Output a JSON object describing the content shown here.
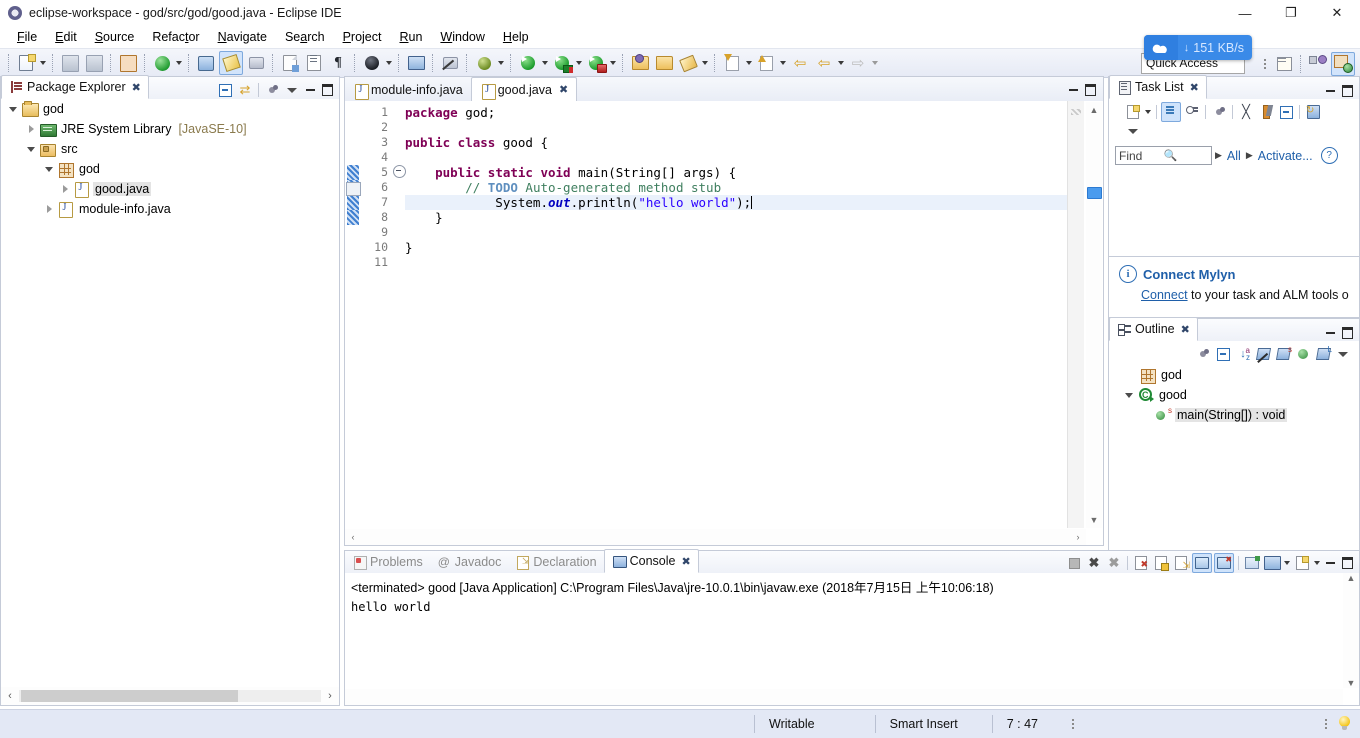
{
  "window": {
    "title": "eclipse-workspace - god/src/god/good.java - Eclipse IDE",
    "icon": "eclipse-icon",
    "minimize": "—",
    "maximize": "❐",
    "close": "✕"
  },
  "menubar": {
    "items": [
      {
        "label": "File",
        "mnemonic": "F"
      },
      {
        "label": "Edit",
        "mnemonic": "E"
      },
      {
        "label": "Source",
        "mnemonic": "S"
      },
      {
        "label": "Refactor",
        "mnemonic": "t"
      },
      {
        "label": "Navigate",
        "mnemonic": "N"
      },
      {
        "label": "Search",
        "mnemonic": "a"
      },
      {
        "label": "Project",
        "mnemonic": "P"
      },
      {
        "label": "Run",
        "mnemonic": "R"
      },
      {
        "label": "Window",
        "mnemonic": "W"
      },
      {
        "label": "Help",
        "mnemonic": "H"
      }
    ]
  },
  "toolbar": {
    "icons": [
      "new-wizard-icon",
      "save-icon",
      "save-all-icon",
      "new-java-project-icon",
      "refresh-icon",
      "debug-skip-icon",
      "edit-pencil-icon",
      "link-icon",
      "export-icon",
      "toggle-block-icon",
      "pilcrow-icon",
      "user-icon",
      "console-icon",
      "no-link-icon",
      "bug-icon",
      "run-icon",
      "run-debug-icon",
      "run-coverage-icon",
      "open-type-icon",
      "open-task-icon",
      "search-icon",
      "next-annotation-icon",
      "previous-annotation-icon",
      "back-icon",
      "forward-icon"
    ]
  },
  "quick_access": {
    "placeholder": "Quick Access",
    "label": "Quick Access"
  },
  "network_badge": {
    "icon": "cloud-icon",
    "arrow": "↓",
    "speed": "151 KB/s"
  },
  "perspective_bar": {
    "buttons": [
      "open-perspective-icon",
      "resource-perspective-icon",
      "java-perspective-icon"
    ],
    "active": "java-perspective-icon"
  },
  "package_explorer": {
    "tab_label": "Package Explorer",
    "tab_icon": "package-explorer-icon",
    "close_glyph": "✖",
    "toolbar": [
      "collapse-all-icon",
      "link-with-editor-icon",
      "view-menu-dots-icon",
      "view-menu-icon"
    ],
    "minimize": "minimize-icon",
    "maximize": "maximize-icon",
    "tree": [
      {
        "label": "god",
        "icon": "project-folder-icon",
        "indent": 0,
        "twisty": "open",
        "suffix": ""
      },
      {
        "label": "JRE System Library",
        "icon": "jre-library-icon",
        "indent": 1,
        "twisty": "closed",
        "suffix": "[JavaSE-10]"
      },
      {
        "label": "src",
        "icon": "source-folder-icon",
        "indent": 1,
        "twisty": "open",
        "suffix": ""
      },
      {
        "label": "god",
        "icon": "package-icon",
        "indent": 2,
        "twisty": "open",
        "suffix": ""
      },
      {
        "label": "good.java",
        "icon": "java-file-icon",
        "indent": 3,
        "twisty": "closed",
        "suffix": "",
        "selected": true
      },
      {
        "label": "module-info.java",
        "icon": "java-file-icon",
        "indent": 2,
        "twisty": "closed",
        "suffix": ""
      }
    ],
    "hscroll": {
      "left_arrow": "‹",
      "right_arrow": "›"
    }
  },
  "editor": {
    "tabs": [
      {
        "label": "module-info.java",
        "icon": "java-file-icon",
        "active": false,
        "closable": false
      },
      {
        "label": "good.java",
        "icon": "java-file-icon",
        "active": true,
        "closable": true,
        "close_glyph": "✖"
      }
    ],
    "minimize": "minimize-icon",
    "maximize": "maximize-icon",
    "line_numbers": [
      "1",
      "2",
      "3",
      "4",
      "5",
      "6",
      "7",
      "8",
      "9",
      "10",
      "11"
    ],
    "current_line": 7,
    "folding_line": 5,
    "lines": [
      {
        "n": 1,
        "tokens": [
          {
            "t": "package ",
            "c": "kw"
          },
          {
            "t": "god;",
            "c": ""
          }
        ]
      },
      {
        "n": 2,
        "tokens": []
      },
      {
        "n": 3,
        "tokens": [
          {
            "t": "public class ",
            "c": "kw"
          },
          {
            "t": "good {",
            "c": ""
          }
        ]
      },
      {
        "n": 4,
        "tokens": []
      },
      {
        "n": 5,
        "tokens": [
          {
            "t": "    ",
            "c": ""
          },
          {
            "t": "public static void ",
            "c": "kw"
          },
          {
            "t": "main(String[] args) {",
            "c": ""
          }
        ]
      },
      {
        "n": 6,
        "tokens": [
          {
            "t": "        ",
            "c": ""
          },
          {
            "t": "// ",
            "c": "cmt"
          },
          {
            "t": "TODO",
            "c": "todo"
          },
          {
            "t": " Auto-generated method stub",
            "c": "cmt"
          }
        ]
      },
      {
        "n": 7,
        "tokens": [
          {
            "t": "            System.",
            "c": ""
          },
          {
            "t": "out",
            "c": "fld"
          },
          {
            "t": ".println(",
            "c": ""
          },
          {
            "t": "\"hello world\"",
            "c": "str"
          },
          {
            "t": ");",
            "c": ""
          }
        ]
      },
      {
        "n": 8,
        "tokens": [
          {
            "t": "    }",
            "c": ""
          }
        ]
      },
      {
        "n": 9,
        "tokens": []
      },
      {
        "n": 10,
        "tokens": [
          {
            "t": "}",
            "c": ""
          }
        ]
      },
      {
        "n": 11,
        "tokens": []
      }
    ],
    "vscroll": {
      "up": "▲",
      "down": "▼"
    },
    "hscroll": {
      "left": "‹",
      "right": "›"
    }
  },
  "task_list": {
    "tab_label": "Task List",
    "tab_icon": "task-list-icon",
    "close_glyph": "✖",
    "toolbar": [
      "new-task-icon",
      "categorized-icon",
      "scheduled-icon",
      "filter-icon",
      "focus-icon",
      "collapse-all-icon",
      "synchronize-icon",
      "view-menu-icon"
    ],
    "find": {
      "placeholder": "Find",
      "value": "",
      "icon": "search-icon"
    },
    "all_label": "All",
    "activate_label": "Activate...",
    "help_glyph": "?",
    "minimize": "minimize-icon",
    "maximize": "maximize-icon"
  },
  "mylyn_notice": {
    "icon": "info-icon",
    "title": "Connect Mylyn",
    "link": "Connect",
    "text": " to your task and ALM tools o"
  },
  "outline": {
    "tab_label": "Outline",
    "tab_icon": "outline-icon",
    "close_glyph": "✖",
    "toolbar": [
      "focus-icon",
      "collapse-all-icon",
      "sort-icon",
      "hide-fields-icon",
      "hide-static-icon",
      "hide-non-public-icon",
      "hide-local-icon",
      "view-menu-icon"
    ],
    "minimize": "minimize-icon",
    "maximize": "maximize-icon",
    "tree": [
      {
        "label": "god",
        "icon": "package-icon",
        "indent": 1,
        "twisty": "",
        "selected": false
      },
      {
        "label": "good",
        "icon": "class-icon",
        "indent": 1,
        "twisty": "open",
        "selected": false
      },
      {
        "label": "main(String[]) : void",
        "icon": "public-method-static-icon",
        "indent": 2,
        "twisty": "",
        "selected": true
      }
    ]
  },
  "bottom_panel": {
    "tabs": [
      {
        "label": "Problems",
        "icon": "problems-icon",
        "active": false
      },
      {
        "label": "Javadoc",
        "icon": "javadoc-icon",
        "active": false
      },
      {
        "label": "Declaration",
        "icon": "declaration-icon",
        "active": false
      },
      {
        "label": "Console",
        "icon": "console-icon",
        "active": true,
        "close_glyph": "✖"
      }
    ],
    "toolbar": [
      "terminate-icon",
      "remove-launch-icon",
      "remove-all-terminated-icon",
      "clear-console-icon",
      "scroll-lock-icon",
      "show-on-output-icon",
      "pin-console-icon",
      "display-selected-console-icon",
      "open-console-icon",
      "new-console-view-icon",
      "view-menu-icon"
    ],
    "minimize": "minimize-icon",
    "maximize": "maximize-icon",
    "console": {
      "header": "<terminated> good [Java Application] C:\\Program Files\\Java\\jre-10.0.1\\bin\\javaw.exe (2018年7月15日 上午10:06:18)",
      "output": "hello world"
    },
    "hscroll": {
      "left": "‹",
      "right": "›"
    }
  },
  "statusbar": {
    "writable": "Writable",
    "insert_mode": "Smart Insert",
    "position": "7 : 47",
    "menu_dots": "menu-dots-icon",
    "bulb": "tip-bulb-icon"
  }
}
